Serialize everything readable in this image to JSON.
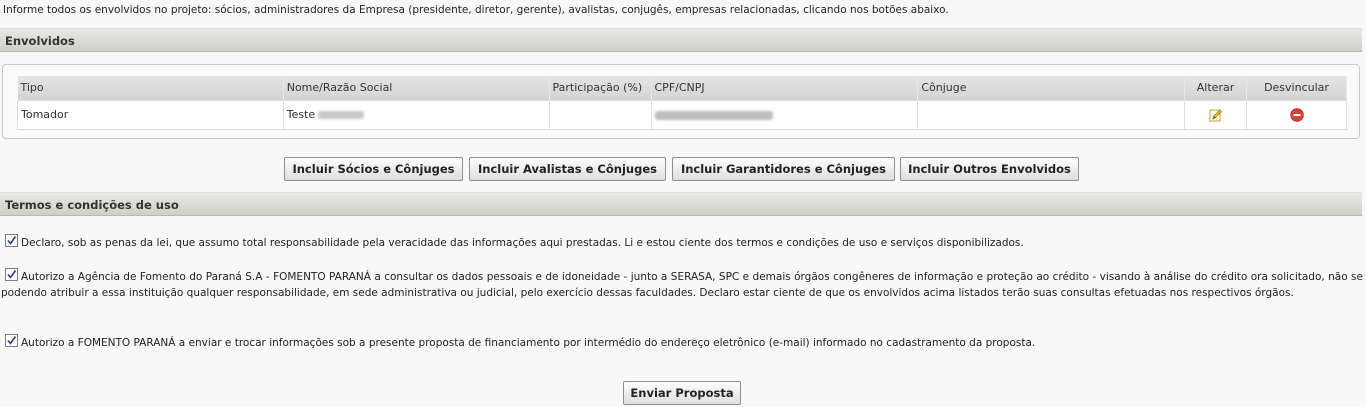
{
  "intro_text": "Informe todos os envolvidos no projeto: sócios, administradores da Empresa (presidente, diretor, gerente), avalistas, conjugês, empresas relacionadas, clicando nos botões abaixo.",
  "envolvidos": {
    "title": "Envolvidos",
    "columns": [
      "Tipo",
      "Nome/Razão Social",
      "Participação (%)",
      "CPF/CNPJ",
      "Cônjuge",
      "Alterar",
      "Desvincular"
    ],
    "rows": [
      {
        "tipo": "Tomador",
        "nome": "Teste",
        "participacao": "",
        "cpf_cnpj": "",
        "conjuge": "",
        "alterar_icon": "edit-pencil-icon",
        "desvincular_icon": "remove-circle-icon"
      }
    ]
  },
  "buttons": {
    "socios": "Incluir Sócios e Cônjuges",
    "avalistas": "Incluir Avalistas e Cônjuges",
    "garantidores": "Incluir Garantidores e Cônjuges",
    "outros": "Incluir Outros Envolvidos"
  },
  "termos": {
    "title": "Termos e condições de uso",
    "items": [
      {
        "checked": true,
        "text": "Declaro, sob as penas da lei, que assumo total responsabilidade pela veracidade das informações aqui prestadas. Li e estou ciente dos termos e condições de uso e serviços disponibilizados."
      },
      {
        "checked": true,
        "text": "Autorizo a Agência de Fomento do Paraná S.A - FOMENTO PARANÁ a consultar os dados pessoais e de idoneidade - junto a SERASA, SPC e demais órgãos congêneres de informação e proteção ao crédito - visando à análise do crédito ora solicitado, não se podendo atribuir a essa instituição qualquer responsabilidade, em sede administrativa ou judicial, pelo exercício dessas faculdades. Declaro estar ciente de que os envolvidos acima listados terão suas consultas efetuadas nos respectivos órgãos."
      },
      {
        "checked": true,
        "text": "Autorizo a FOMENTO PARANÁ a enviar e trocar informações sob a presente proposta de financiamento por intermédio do endereço eletrônico (e-mail) informado no cadastramento da proposta."
      }
    ]
  },
  "submit_label": "Enviar Proposta",
  "colors": {
    "header_gradient_top": "#e9e9e4",
    "header_gradient_bottom": "#cfcfc9",
    "remove_icon": "#e0403a",
    "edit_icon": "#f2c94c"
  }
}
